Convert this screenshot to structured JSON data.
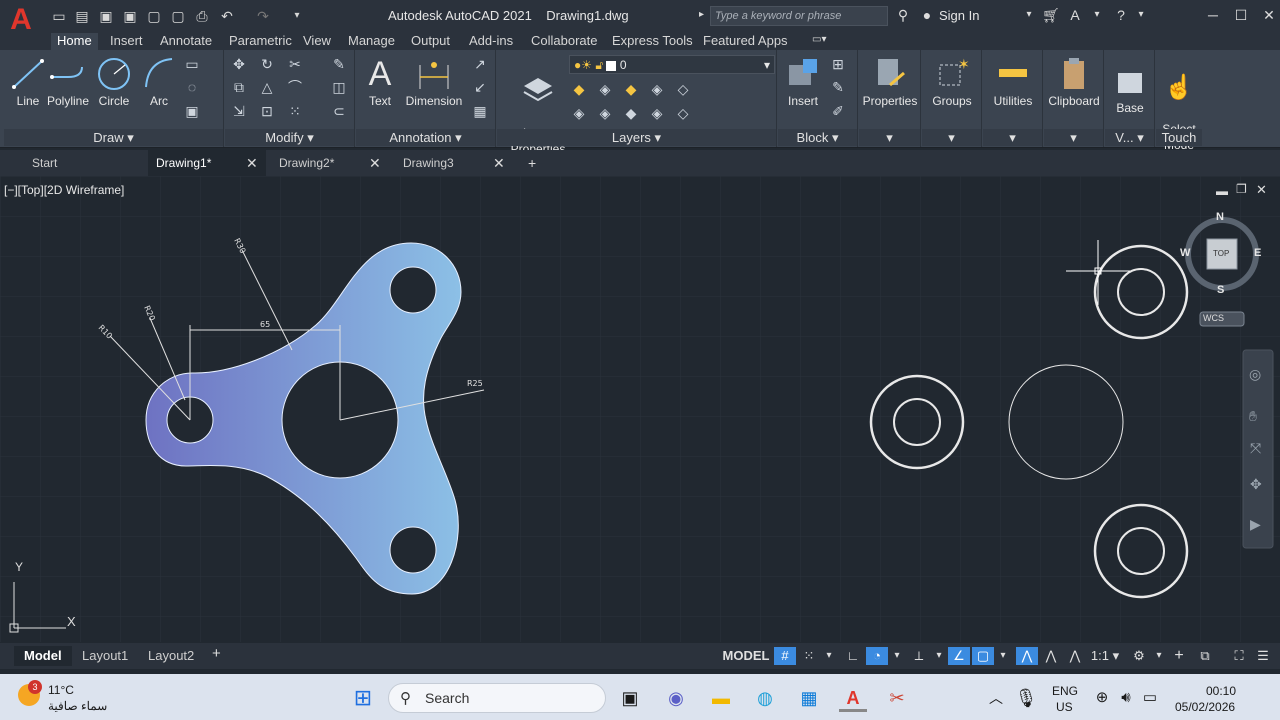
{
  "app": {
    "title": "Autodesk AutoCAD 2021",
    "document": "Drawing1.dwg",
    "search_placeholder": "Type a keyword or phrase",
    "sign_in": "Sign In",
    "brand_color": "#e0362c",
    "accent_color": "#3b8be0"
  },
  "ribbon_tabs": [
    "Home",
    "Insert",
    "Annotate",
    "Parametric",
    "View",
    "Manage",
    "Output",
    "Add-ins",
    "Collaborate",
    "Express Tools",
    "Featured Apps"
  ],
  "active_ribbon_tab": "Home",
  "ribbon": {
    "draw": {
      "title": "Draw",
      "line": "Line",
      "polyline": "Polyline",
      "circle": "Circle",
      "arc": "Arc"
    },
    "modify": {
      "title": "Modify"
    },
    "annotation": {
      "title": "Annotation",
      "text": "Text",
      "dimension": "Dimension"
    },
    "layers": {
      "title": "Layers",
      "layer_properties": "Layer\nProperties",
      "current_layer": "0"
    },
    "block": {
      "title": "Block",
      "insert": "Insert"
    },
    "properties": "Properties",
    "groups": "Groups",
    "utilities": "Utilities",
    "clipboard": "Clipboard",
    "view": {
      "base": "Base",
      "title": "V..."
    },
    "touch": {
      "select_mode": "Select\nMode",
      "title": "Touch"
    }
  },
  "doc_tabs": [
    {
      "label": "Start",
      "closable": false
    },
    {
      "label": "Drawing1*",
      "closable": true,
      "active": true
    },
    {
      "label": "Drawing2*",
      "closable": true
    },
    {
      "label": "Drawing3",
      "closable": true
    }
  ],
  "viewport": {
    "label": "[−][Top][2D Wireframe]",
    "viewcube": {
      "top": "TOP",
      "n": "N",
      "s": "S",
      "e": "E",
      "w": "W",
      "wcs": "WCS"
    },
    "ucs": {
      "x": "X",
      "y": "Y"
    }
  },
  "drawing": {
    "dims": {
      "r30": "R30",
      "r20": "R20",
      "r10": "R10",
      "d65": "65",
      "r25": "R25"
    }
  },
  "layout_tabs": [
    {
      "label": "Model",
      "active": true
    },
    {
      "label": "Layout1"
    },
    {
      "label": "Layout2"
    }
  ],
  "status": {
    "model": "MODEL",
    "scale": "1:1"
  },
  "taskbar": {
    "weather_temp": "11°C",
    "weather_desc": "سماء صافية",
    "weather_badge": "3",
    "search": "Search",
    "lang": "ENG",
    "region": "US",
    "time": "00:10",
    "date": "05/02/2026"
  }
}
